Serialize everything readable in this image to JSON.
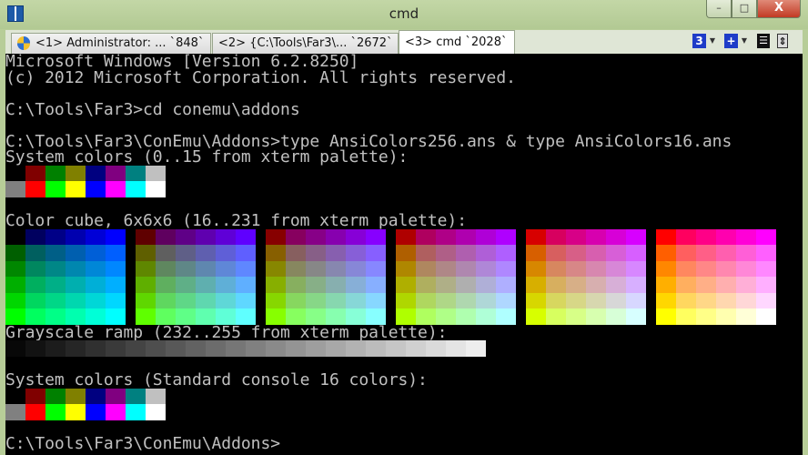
{
  "window": {
    "title": "cmd",
    "min_label": "–",
    "max_label": "□",
    "close_label": "X"
  },
  "tabs": [
    {
      "label": "<1> Administrator: ... `848`",
      "icon": "uac-shield-icon"
    },
    {
      "label": "<2> {C:\\Tools\\Far3\\... `2672`"
    },
    {
      "label": "<3> cmd  `2028`",
      "active": true
    }
  ],
  "toolbar": {
    "console_number": "3",
    "new_console": "+",
    "menu_glyph": "☰",
    "scroll_glyph": "⇕"
  },
  "console": {
    "lines": [
      "Microsoft Windows [Version 6.2.8250]",
      "(c) 2012 Microsoft Corporation. All rights reserved.",
      "",
      "C:\\Tools\\Far3>cd conemu\\addons",
      "",
      "C:\\Tools\\Far3\\ConEmu\\Addons>type AnsiColors256.ans & type AnsiColors16.ans",
      "System colors (0..15 from xterm palette):",
      "",
      "",
      "",
      "Color cube, 6x6x6 (16..231 from xterm palette):",
      "",
      "",
      "",
      "",
      "",
      "",
      "Grayscale ramp (232..255 from xterm palette):",
      "",
      "",
      "System colors (Standard console 16 colors):",
      "",
      "",
      "",
      "C:\\Tools\\Far3\\ConEmu\\Addons>"
    ],
    "system_colors": [
      "#000000",
      "#800000",
      "#008000",
      "#808000",
      "#000080",
      "#800080",
      "#008080",
      "#c0c0c0",
      "#808080",
      "#ff0000",
      "#00ff00",
      "#ffff00",
      "#0000ff",
      "#ff00ff",
      "#00ffff",
      "#ffffff"
    ],
    "cube_levels": [
      0,
      95,
      135,
      175,
      215,
      255
    ],
    "gray_start": 8,
    "gray_step": 10,
    "gray_count": 24
  }
}
